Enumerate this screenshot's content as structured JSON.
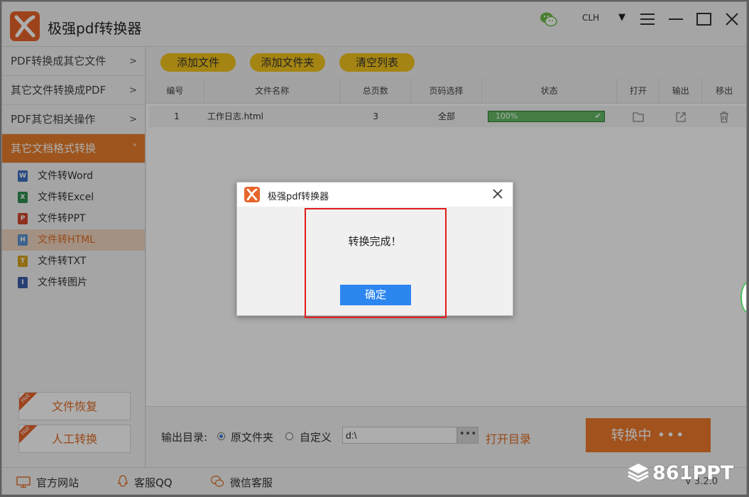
{
  "app": {
    "title": "极强pdf转换器",
    "user": "CLH",
    "version": "V 3.2.0"
  },
  "sidebar": {
    "categories": [
      {
        "label": "PDF转换成其它文件",
        "arrow": ">"
      },
      {
        "label": "其它文件转换成PDF",
        "arrow": ">"
      },
      {
        "label": "PDF其它相关操作",
        "arrow": ">"
      },
      {
        "label": "其它文档格式转换",
        "arrow": "˅"
      }
    ],
    "items": [
      {
        "label": "文件转Word",
        "icon": "W"
      },
      {
        "label": "文件转Excel",
        "icon": "X"
      },
      {
        "label": "文件转PPT",
        "icon": "P"
      },
      {
        "label": "文件转HTML",
        "icon": "H"
      },
      {
        "label": "文件转TXT",
        "icon": "T"
      },
      {
        "label": "文件转图片",
        "icon": "I"
      }
    ],
    "actions": [
      {
        "label": "文件恢复",
        "badge": "Hot"
      },
      {
        "label": "人工转换",
        "badge": "Hot"
      }
    ]
  },
  "toolbar": {
    "add_file": "添加文件",
    "add_folder": "添加文件夹",
    "clear_list": "清空列表"
  },
  "table": {
    "headers": [
      "编号",
      "文件名称",
      "总页数",
      "页码选择",
      "状态",
      "打开",
      "输出",
      "移出"
    ],
    "rows": [
      {
        "num": "1",
        "name": "工作日志.html",
        "pages": "3",
        "range": "全部",
        "status": "100%",
        "progress": 1.0
      }
    ]
  },
  "output": {
    "label": "输出目录:",
    "option_source": "原文件夹",
    "option_custom": "自定义",
    "path": "d:\\",
    "browse": "•••",
    "open_dir": "打开目录"
  },
  "convert": {
    "label": "转换中",
    "dots": "•••"
  },
  "statusbar": {
    "website": "官方网站",
    "qq": "客服QQ",
    "wechat": "微信客服"
  },
  "dialog": {
    "title": "极强pdf转换器",
    "message": "转换完成！",
    "ok": "确定"
  },
  "watermark": "861PPT",
  "colors": {
    "accent": "#e87e2b",
    "tool_button": "#f2c31b",
    "ok_button": "#2d86f0",
    "highlight": "#e11b1b",
    "progress": "#63b964"
  }
}
